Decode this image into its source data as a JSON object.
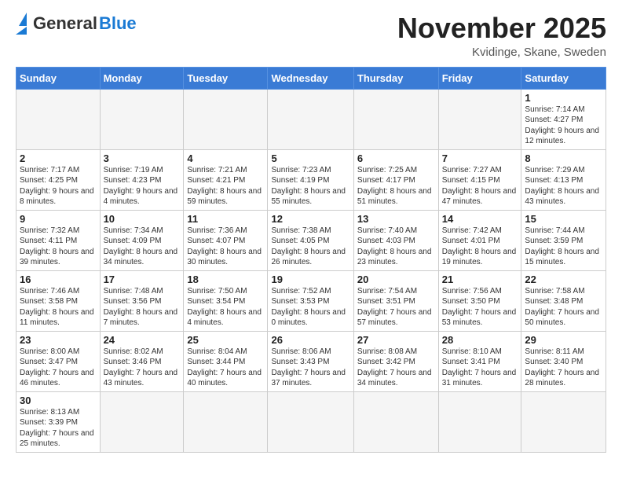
{
  "header": {
    "logo_general": "General",
    "logo_blue": "Blue",
    "month_title": "November 2025",
    "location": "Kvidinge, Skane, Sweden"
  },
  "weekdays": [
    "Sunday",
    "Monday",
    "Tuesday",
    "Wednesday",
    "Thursday",
    "Friday",
    "Saturday"
  ],
  "weeks": [
    [
      {
        "day": "",
        "info": ""
      },
      {
        "day": "",
        "info": ""
      },
      {
        "day": "",
        "info": ""
      },
      {
        "day": "",
        "info": ""
      },
      {
        "day": "",
        "info": ""
      },
      {
        "day": "",
        "info": ""
      },
      {
        "day": "1",
        "info": "Sunrise: 7:14 AM\nSunset: 4:27 PM\nDaylight: 9 hours and 12 minutes."
      }
    ],
    [
      {
        "day": "2",
        "info": "Sunrise: 7:17 AM\nSunset: 4:25 PM\nDaylight: 9 hours and 8 minutes."
      },
      {
        "day": "3",
        "info": "Sunrise: 7:19 AM\nSunset: 4:23 PM\nDaylight: 9 hours and 4 minutes."
      },
      {
        "day": "4",
        "info": "Sunrise: 7:21 AM\nSunset: 4:21 PM\nDaylight: 8 hours and 59 minutes."
      },
      {
        "day": "5",
        "info": "Sunrise: 7:23 AM\nSunset: 4:19 PM\nDaylight: 8 hours and 55 minutes."
      },
      {
        "day": "6",
        "info": "Sunrise: 7:25 AM\nSunset: 4:17 PM\nDaylight: 8 hours and 51 minutes."
      },
      {
        "day": "7",
        "info": "Sunrise: 7:27 AM\nSunset: 4:15 PM\nDaylight: 8 hours and 47 minutes."
      },
      {
        "day": "8",
        "info": "Sunrise: 7:29 AM\nSunset: 4:13 PM\nDaylight: 8 hours and 43 minutes."
      }
    ],
    [
      {
        "day": "9",
        "info": "Sunrise: 7:32 AM\nSunset: 4:11 PM\nDaylight: 8 hours and 39 minutes."
      },
      {
        "day": "10",
        "info": "Sunrise: 7:34 AM\nSunset: 4:09 PM\nDaylight: 8 hours and 34 minutes."
      },
      {
        "day": "11",
        "info": "Sunrise: 7:36 AM\nSunset: 4:07 PM\nDaylight: 8 hours and 30 minutes."
      },
      {
        "day": "12",
        "info": "Sunrise: 7:38 AM\nSunset: 4:05 PM\nDaylight: 8 hours and 26 minutes."
      },
      {
        "day": "13",
        "info": "Sunrise: 7:40 AM\nSunset: 4:03 PM\nDaylight: 8 hours and 23 minutes."
      },
      {
        "day": "14",
        "info": "Sunrise: 7:42 AM\nSunset: 4:01 PM\nDaylight: 8 hours and 19 minutes."
      },
      {
        "day": "15",
        "info": "Sunrise: 7:44 AM\nSunset: 3:59 PM\nDaylight: 8 hours and 15 minutes."
      }
    ],
    [
      {
        "day": "16",
        "info": "Sunrise: 7:46 AM\nSunset: 3:58 PM\nDaylight: 8 hours and 11 minutes."
      },
      {
        "day": "17",
        "info": "Sunrise: 7:48 AM\nSunset: 3:56 PM\nDaylight: 8 hours and 7 minutes."
      },
      {
        "day": "18",
        "info": "Sunrise: 7:50 AM\nSunset: 3:54 PM\nDaylight: 8 hours and 4 minutes."
      },
      {
        "day": "19",
        "info": "Sunrise: 7:52 AM\nSunset: 3:53 PM\nDaylight: 8 hours and 0 minutes."
      },
      {
        "day": "20",
        "info": "Sunrise: 7:54 AM\nSunset: 3:51 PM\nDaylight: 7 hours and 57 minutes."
      },
      {
        "day": "21",
        "info": "Sunrise: 7:56 AM\nSunset: 3:50 PM\nDaylight: 7 hours and 53 minutes."
      },
      {
        "day": "22",
        "info": "Sunrise: 7:58 AM\nSunset: 3:48 PM\nDaylight: 7 hours and 50 minutes."
      }
    ],
    [
      {
        "day": "23",
        "info": "Sunrise: 8:00 AM\nSunset: 3:47 PM\nDaylight: 7 hours and 46 minutes."
      },
      {
        "day": "24",
        "info": "Sunrise: 8:02 AM\nSunset: 3:46 PM\nDaylight: 7 hours and 43 minutes."
      },
      {
        "day": "25",
        "info": "Sunrise: 8:04 AM\nSunset: 3:44 PM\nDaylight: 7 hours and 40 minutes."
      },
      {
        "day": "26",
        "info": "Sunrise: 8:06 AM\nSunset: 3:43 PM\nDaylight: 7 hours and 37 minutes."
      },
      {
        "day": "27",
        "info": "Sunrise: 8:08 AM\nSunset: 3:42 PM\nDaylight: 7 hours and 34 minutes."
      },
      {
        "day": "28",
        "info": "Sunrise: 8:10 AM\nSunset: 3:41 PM\nDaylight: 7 hours and 31 minutes."
      },
      {
        "day": "29",
        "info": "Sunrise: 8:11 AM\nSunset: 3:40 PM\nDaylight: 7 hours and 28 minutes."
      }
    ],
    [
      {
        "day": "30",
        "info": "Sunrise: 8:13 AM\nSunset: 3:39 PM\nDaylight: 7 hours and 25 minutes."
      },
      {
        "day": "",
        "info": ""
      },
      {
        "day": "",
        "info": ""
      },
      {
        "day": "",
        "info": ""
      },
      {
        "day": "",
        "info": ""
      },
      {
        "day": "",
        "info": ""
      },
      {
        "day": "",
        "info": ""
      }
    ]
  ]
}
